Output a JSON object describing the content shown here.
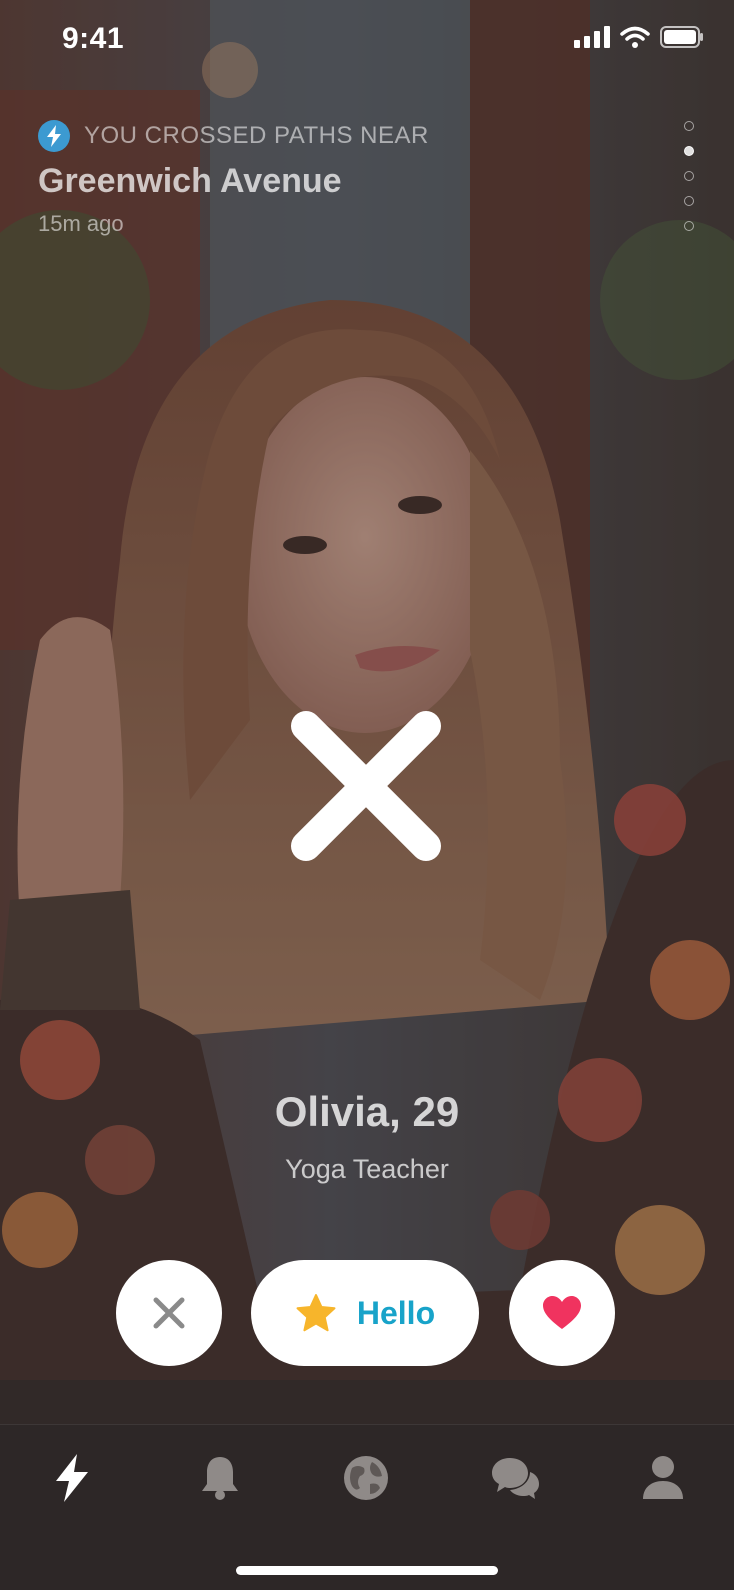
{
  "status_bar": {
    "time": "9:41"
  },
  "crossed_paths": {
    "label": "YOU CROSSED PATHS NEAR",
    "location": "Greenwich Avenue",
    "time_ago": "15m ago"
  },
  "photo_pager": {
    "count": 5,
    "active_index": 1
  },
  "profile": {
    "name_age": "Olivia, 29",
    "occupation": "Yoga Teacher"
  },
  "actions": {
    "hello_label": "Hello"
  },
  "tabs": [
    {
      "name": "feed",
      "icon": "bolt-icon",
      "active": true
    },
    {
      "name": "notifications",
      "icon": "bell-icon",
      "active": false
    },
    {
      "name": "explore",
      "icon": "globe-icon",
      "active": false
    },
    {
      "name": "chats",
      "icon": "chat-bubbles-icon",
      "active": false
    },
    {
      "name": "profile",
      "icon": "person-icon",
      "active": false
    }
  ],
  "colors": {
    "accent_blue": "#18a3c9",
    "heart_pink": "#f0335f",
    "star_yellow": "#f7b52b",
    "badge_blue": "#3c9ad1"
  }
}
